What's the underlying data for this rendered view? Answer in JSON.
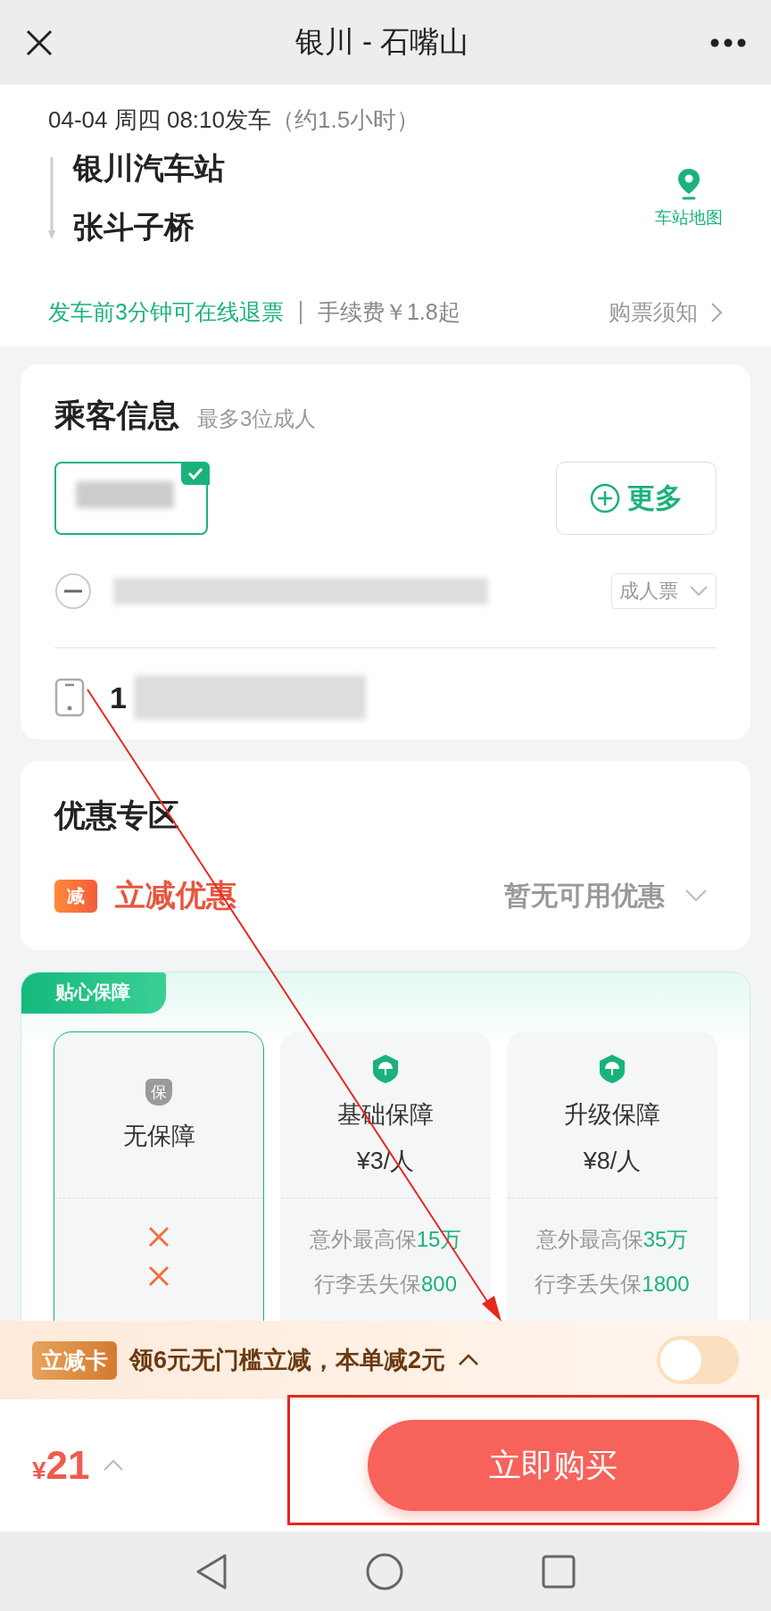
{
  "header": {
    "title": "银川 - 石嘴山"
  },
  "trip": {
    "departure": "04-04 周四 08:10发车",
    "duration": "（约1.5小时）",
    "from": "银川汽车站",
    "to": "张斗子桥",
    "map_label": "车站地图",
    "refund_note": "发车前3分钟可在线退票",
    "fee": "手续费￥1.8起",
    "notice": "购票须知"
  },
  "passengers": {
    "title": "乘客信息",
    "hint": "最多3位成人",
    "chips": [
      {
        "selected": true
      }
    ],
    "more_button": "更多",
    "ticket_type": "成人票",
    "phone_prefix": "1"
  },
  "discounts": {
    "title": "优惠专区",
    "badge": "减",
    "label": "立减优惠",
    "status": "暂无可用优惠"
  },
  "insurance": {
    "tab": "贴心保障",
    "plans": [
      {
        "kind": "none",
        "selected": true,
        "badge": "保",
        "name": "无保障"
      },
      {
        "kind": "paid",
        "selected": false,
        "name": "基础保障",
        "price": "¥3/人",
        "accident_label": "意外最高保",
        "accident_value": "15万",
        "luggage_label": "行李丢失保",
        "luggage_value": "800"
      },
      {
        "kind": "paid",
        "selected": false,
        "name": "升级保障",
        "price": "¥8/人",
        "accident_label": "意外最高保",
        "accident_value": "35万",
        "luggage_label": "行李丢失保",
        "luggage_value": "1800"
      }
    ]
  },
  "coupon": {
    "badge": "立减卡",
    "text": "领6元无门槛立减，本单减2元",
    "on": false
  },
  "footer": {
    "currency": "¥",
    "amount": "21",
    "buy_button": "立即购买"
  }
}
